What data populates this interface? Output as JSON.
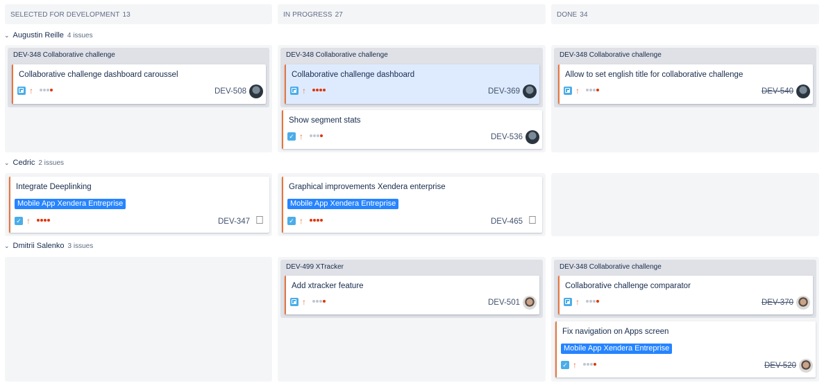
{
  "columns": [
    {
      "name": "SELECTED FOR DEVELOPMENT",
      "count": "13"
    },
    {
      "name": "IN PROGRESS",
      "count": "27"
    },
    {
      "name": "DONE",
      "count": "34"
    }
  ],
  "swimlanes": [
    {
      "name": "Augustin Reille",
      "count": "4 issues"
    },
    {
      "name": "Cedric",
      "count": "2 issues"
    },
    {
      "name": "Dmitrii Salenko",
      "count": "3 issues"
    }
  ],
  "epics": {
    "e1": "DEV-348 Collaborative challenge",
    "e2": "DEV-348 Collaborative challenge",
    "e3": "DEV-348 Collaborative challenge",
    "e4": "DEV-499 XTracker",
    "e5": "DEV-348 Collaborative challenge"
  },
  "cards": {
    "c508": {
      "title": "Collaborative challenge dashboard caroussel",
      "key": "DEV-508"
    },
    "c369": {
      "title": "Collaborative challenge dashboard",
      "key": "DEV-369"
    },
    "c536": {
      "title": "Show segment stats",
      "key": "DEV-536"
    },
    "c540": {
      "title": "Allow to set english title for collaborative challenge",
      "key": "DEV-540"
    },
    "c347": {
      "title": "Integrate Deeplinking",
      "label": "Mobile App Xendera Entreprise",
      "key": "DEV-347"
    },
    "c465": {
      "title": "Graphical improvements Xendera enterprise",
      "label": "Mobile App Xendera Entreprise",
      "key": "DEV-465"
    },
    "c501": {
      "title": "Add xtracker feature",
      "key": "DEV-501"
    },
    "c370": {
      "title": "Collaborative challenge comparator",
      "key": "DEV-370"
    },
    "c520": {
      "title": "Fix navigation on Apps screen",
      "label": "Mobile App Xendera Entreprise",
      "key": "DEV-520"
    }
  },
  "colors": {
    "priority": "#e8743c",
    "label": "#2684ff",
    "selected": "#deebff"
  }
}
